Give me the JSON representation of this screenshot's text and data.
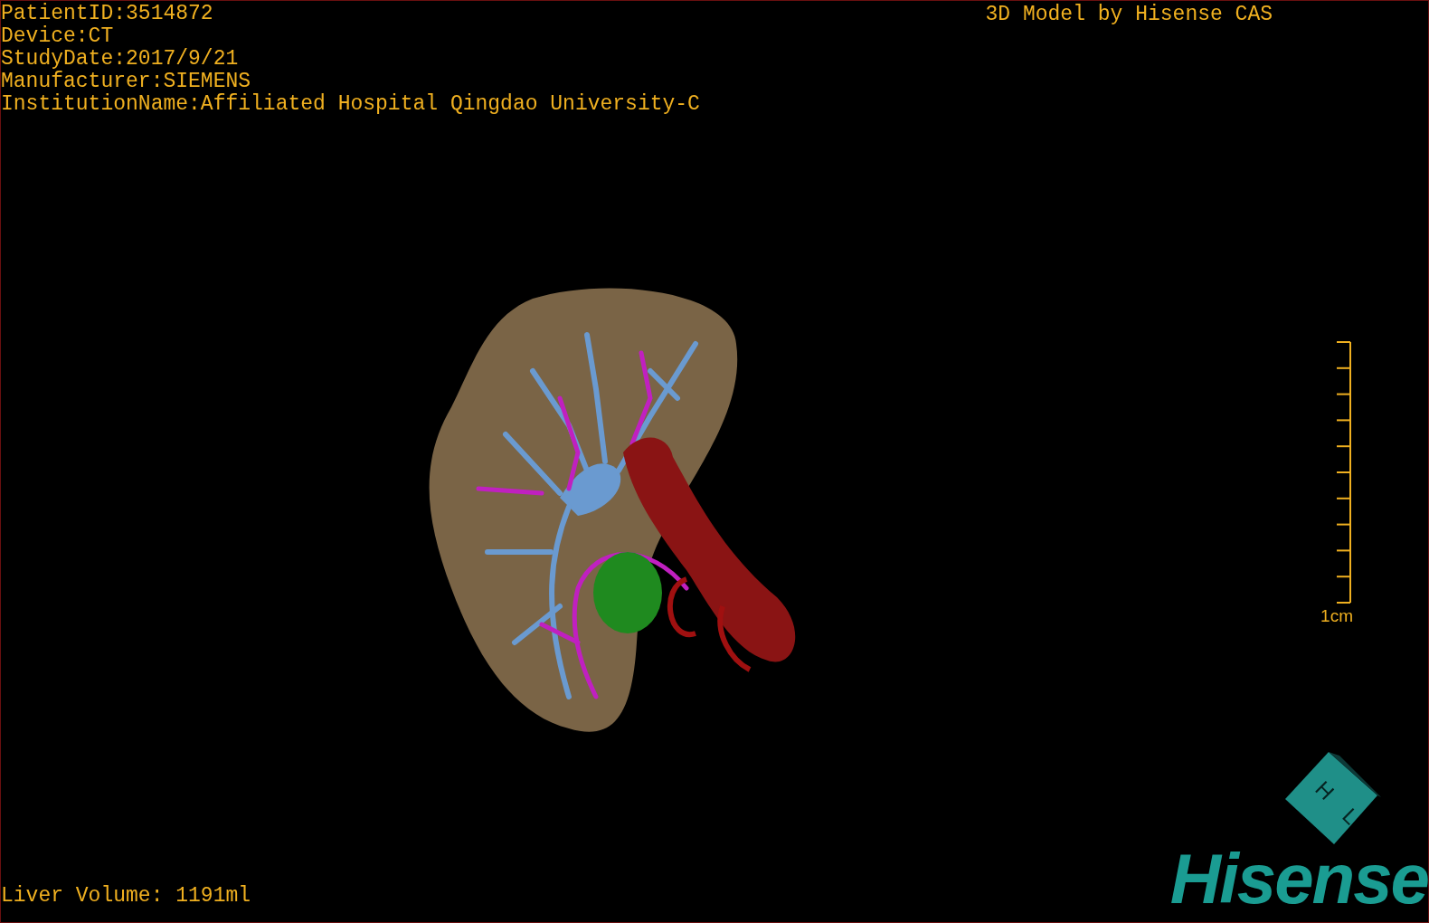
{
  "info_lines": [
    "PatientID:3514872",
    "Device:CT",
    "StudyDate:2017/9/21",
    "Manufacturer:SIEMENS",
    "InstitutionName:Affiliated Hospital Qingdao University-C"
  ],
  "title": "3D Model by Hisense CAS",
  "scale_bar": {
    "label": "1cm"
  },
  "volume": "Liver Volume: 1191ml",
  "orientation_cube": {
    "labels": [
      "H",
      "L"
    ]
  },
  "logo": "Hisense"
}
